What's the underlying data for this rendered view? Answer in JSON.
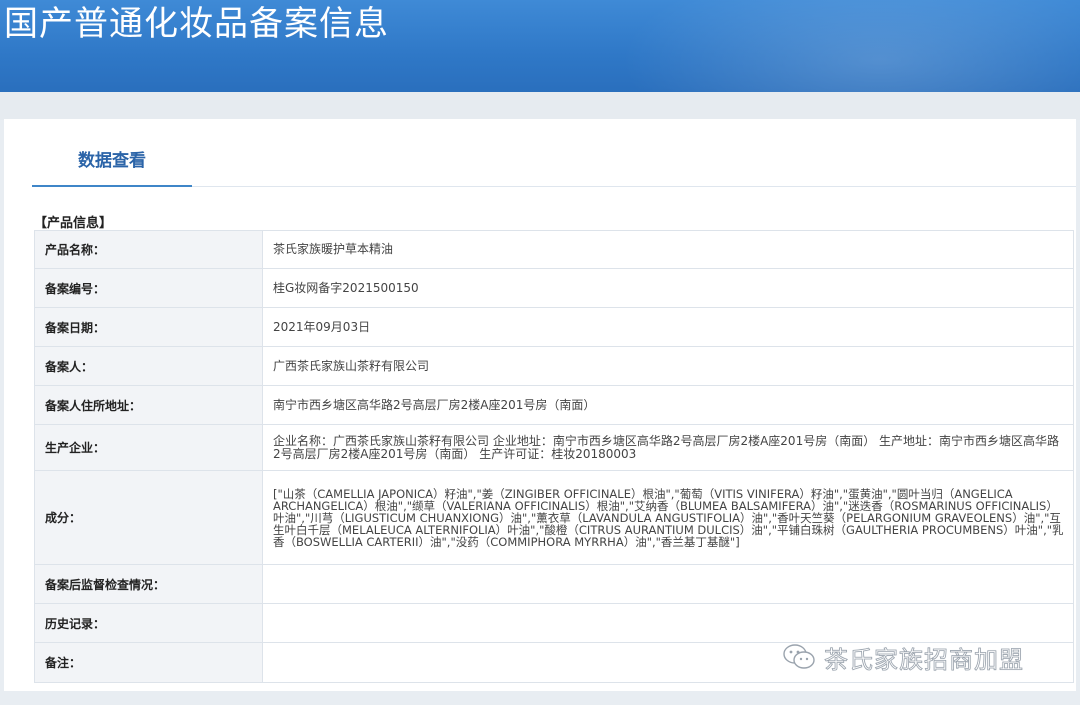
{
  "header": {
    "title": "国产普通化妆品备案信息"
  },
  "tabs": [
    {
      "label": "数据查看"
    }
  ],
  "section": {
    "title": "【产品信息】"
  },
  "rows": [
    {
      "label": "产品名称：",
      "value": "茶氏家族暖护草本精油"
    },
    {
      "label": "备案编号：",
      "value": "桂G妆网备字2021500150"
    },
    {
      "label": "备案日期：",
      "value": "2021年09月03日"
    },
    {
      "label": "备案人：",
      "value": "广西茶氏家族山茶籽有限公司"
    },
    {
      "label": "备案人住所地址：",
      "value": "南宁市西乡塘区高华路2号高层厂房2楼A座201号房（南面）"
    },
    {
      "label": "生产企业：",
      "value": "企业名称：广西茶氏家族山茶籽有限公司 企业地址：南宁市西乡塘区高华路2号高层厂房2楼A座201号房（南面） 生产地址：南宁市西乡塘区高华路2号高层厂房2楼A座201号房（南面） 生产许可证：桂妆20180003"
    },
    {
      "label": "成分：",
      "value": "[\"山茶（CAMELLIA JAPONICA）籽油\",\"姜（ZINGIBER OFFICINALE）根油\",\"葡萄（VITIS VINIFERA）籽油\",\"蛋黄油\",\"圆叶当归（ANGELICA ARCHANGELICA）根油\",\"缬草（VALERIANA OFFICINALIS）根油\",\"艾纳香（BLUMEA BALSAMIFERA）油\",\"迷迭香（ROSMARINUS OFFICINALIS）叶油\",\"川芎（LIGUSTICUM CHUANXIONG）油\",\"薰衣草（LAVANDULA ANGUSTIFOLIA）油\",\"香叶天竺葵（PELARGONIUM GRAVEOLENS）油\",\"互生叶白千层（MELALEUCA ALTERNIFOLIA）叶油\",\"酸橙（CITRUS AURANTIUM DULCIS）油\",\"平铺白珠树（GAULTHERIA PROCUMBENS）叶油\",\"乳香（BOSWELLIA CARTERII）油\",\"没药（COMMIPHORA MYRRHA）油\",\"香兰基丁基醚\"]"
    },
    {
      "label": "备案后监督检查情况：",
      "value": ""
    },
    {
      "label": "历史记录：",
      "value": ""
    },
    {
      "label": "备注：",
      "value": ""
    }
  ],
  "watermark": {
    "text": "茶氏家族招商加盟",
    "icon": "wechat-icon"
  },
  "colors": {
    "banner": "#2f78c7",
    "tab_text": "#2b64a8",
    "label_bg": "#f2f4f7"
  }
}
